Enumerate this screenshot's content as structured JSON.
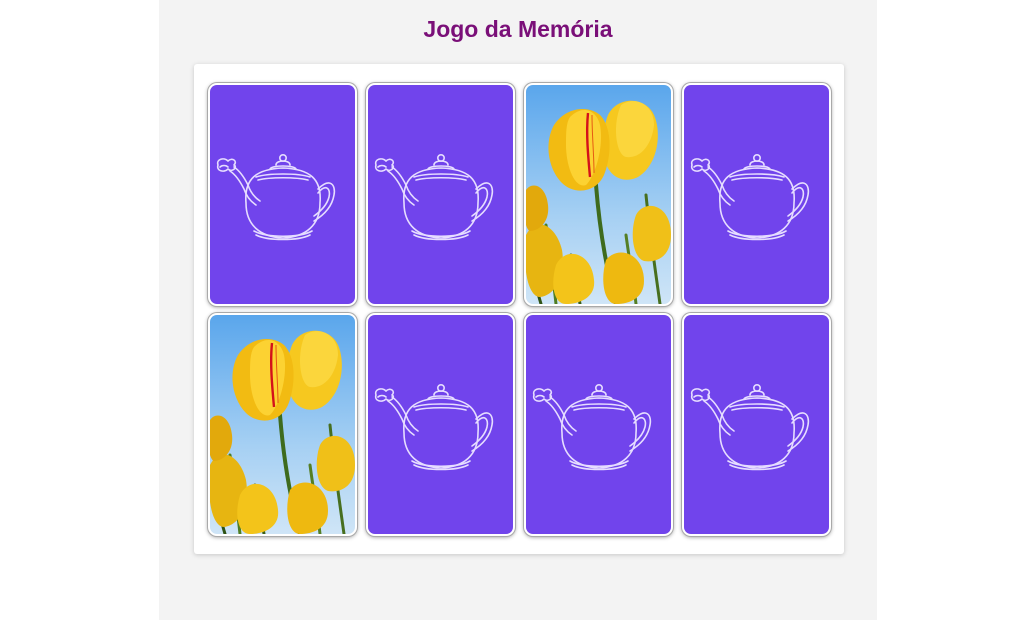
{
  "header": {
    "title": "Jogo da Memória"
  },
  "colors": {
    "title": "#7a0f78",
    "card_back": "#7144ec",
    "page_background": "#f3f3f3",
    "board_background": "#ffffff"
  },
  "board": {
    "rows": 2,
    "columns": 4,
    "cards": [
      {
        "state": "face-down",
        "icon": "teapot-icon"
      },
      {
        "state": "face-down",
        "icon": "teapot-icon"
      },
      {
        "state": "face-up",
        "icon": "yellow-tulips-image"
      },
      {
        "state": "face-down",
        "icon": "teapot-icon"
      },
      {
        "state": "face-up",
        "icon": "yellow-tulips-image"
      },
      {
        "state": "face-down",
        "icon": "teapot-icon"
      },
      {
        "state": "face-down",
        "icon": "teapot-icon"
      },
      {
        "state": "face-down",
        "icon": "teapot-icon"
      }
    ]
  }
}
